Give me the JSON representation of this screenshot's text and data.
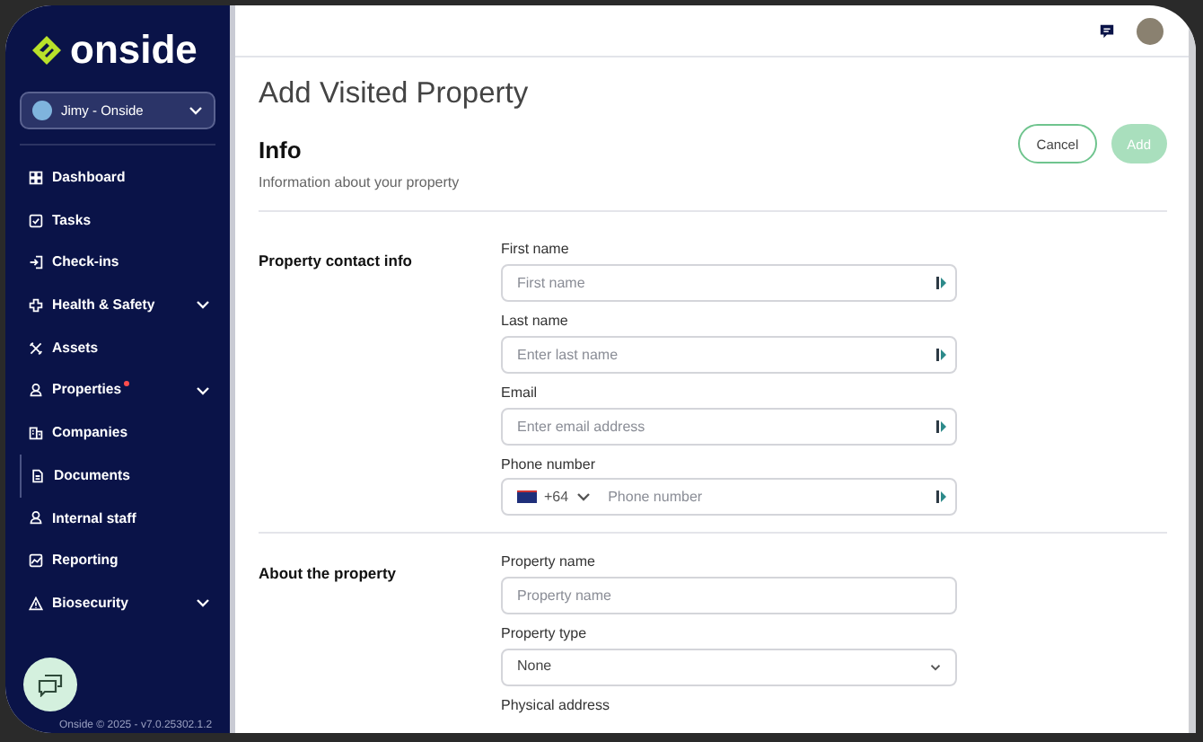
{
  "sidebar": {
    "logo": "onside",
    "account": {
      "name": "Jimy - Onside"
    },
    "items": [
      {
        "label": "Dashboard",
        "kind": "link",
        "selected": false,
        "alert": false
      },
      {
        "label": "Tasks",
        "kind": "link",
        "selected": false,
        "alert": false
      },
      {
        "label": "Check-ins",
        "kind": "link",
        "selected": false,
        "alert": false
      },
      {
        "label": "Health & Safety",
        "kind": "group",
        "selected": false,
        "alert": false
      },
      {
        "label": "Assets",
        "kind": "link",
        "selected": false,
        "alert": false
      },
      {
        "label": "Properties",
        "kind": "group",
        "selected": false,
        "alert": true
      },
      {
        "label": "Companies",
        "kind": "link",
        "selected": false,
        "alert": false
      },
      {
        "label": "Documents",
        "kind": "link",
        "selected": true,
        "alert": false
      },
      {
        "label": "Internal staff",
        "kind": "link",
        "selected": false,
        "alert": false
      },
      {
        "label": "Reporting",
        "kind": "link",
        "selected": false,
        "alert": false
      },
      {
        "label": "Biosecurity",
        "kind": "group",
        "selected": false,
        "alert": false
      }
    ],
    "footer": "Onside © 2025 - v7.0.25302.1.2"
  },
  "page": {
    "title": "Add Visited Property",
    "section_title": "Info",
    "section_subtitle": "Information about your property",
    "buttons": [
      {
        "label": "Cancel",
        "kind": "outline",
        "disabled": false
      },
      {
        "label": "Add",
        "kind": "primary",
        "disabled": true
      }
    ]
  },
  "groups": [
    {
      "title": "Property contact info",
      "fields": [
        {
          "label": "First name",
          "kind": "text",
          "placeholder": "First name",
          "autofill_icon": true
        },
        {
          "label": "Last name",
          "kind": "text",
          "placeholder": "Enter last name",
          "autofill_icon": true
        },
        {
          "label": "Email",
          "kind": "text",
          "placeholder": "Enter email address",
          "autofill_icon": true
        },
        {
          "label": "Phone number",
          "kind": "phone",
          "country_code": "+64",
          "placeholder": "Phone number",
          "autofill_icon": true
        }
      ]
    },
    {
      "title": "About the property",
      "fields": [
        {
          "label": "Property name",
          "kind": "text",
          "placeholder": "Property name",
          "autofill_icon": false
        },
        {
          "label": "Property type",
          "kind": "select",
          "value": "None",
          "autofill_icon": false
        },
        {
          "label": "Physical address",
          "kind": "label_only"
        }
      ]
    }
  ]
}
